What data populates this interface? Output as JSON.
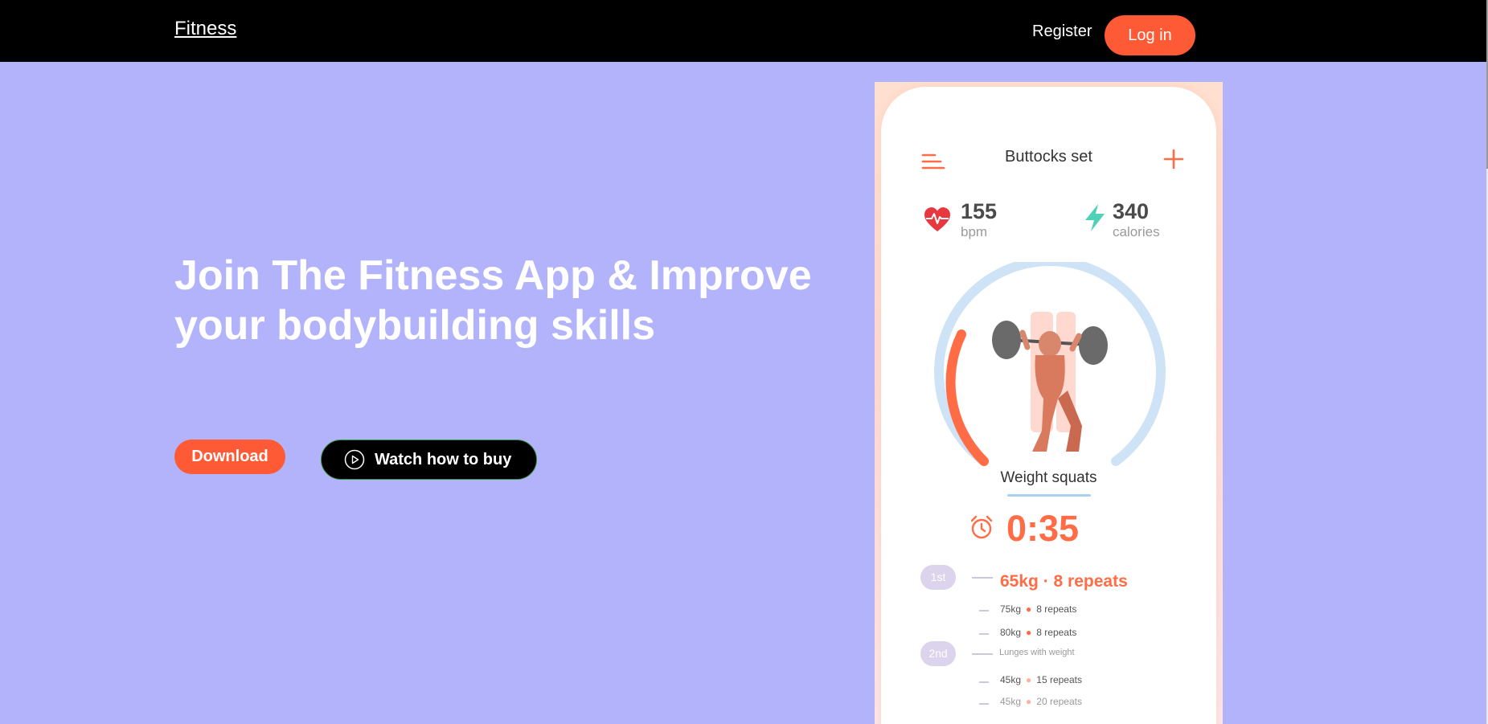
{
  "nav": {
    "brand": "Fitness",
    "register": "Register",
    "login": "Log in"
  },
  "hero": {
    "title": "Join The Fitness App & Improve your bodybuilding skills",
    "download": "Download",
    "watch": "Watch how to buy"
  },
  "phone": {
    "title": "Buttocks set",
    "stats": [
      {
        "value": "155",
        "unit": "bpm",
        "icon": "heart-icon",
        "color": "#e8373f"
      },
      {
        "value": "340",
        "unit": "calories",
        "icon": "lightning-icon",
        "color": "#4fd1b8"
      }
    ],
    "exercise": "Weight squats",
    "timer": "0:35",
    "sets": [
      {
        "label": "1st",
        "main": "65kg · 8 repeats",
        "rows": [
          {
            "weight": "75kg",
            "reps": "8 repeats"
          },
          {
            "weight": "80kg",
            "reps": "8 repeats"
          }
        ]
      },
      {
        "label": "2nd",
        "main": "Lunges with weight",
        "rows": [
          {
            "weight": "45kg",
            "reps": "15 repeats"
          },
          {
            "weight": "45kg",
            "reps": "20 repeats"
          }
        ]
      }
    ]
  },
  "colors": {
    "accent": "#ff5a36",
    "background": "#b3b3fc",
    "navbar": "#000000"
  }
}
